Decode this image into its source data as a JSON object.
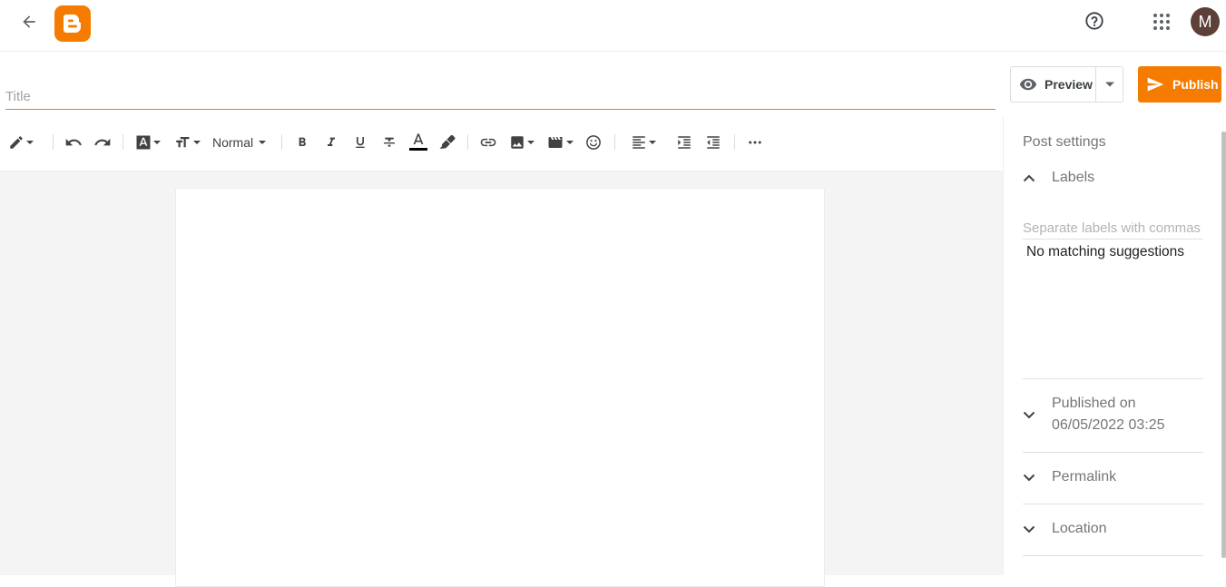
{
  "header": {
    "avatar_initial": "M"
  },
  "editor": {
    "title_placeholder": "Title",
    "preview_label": "Preview",
    "publish_label": "Publish",
    "format_label": "Normal"
  },
  "sidebar": {
    "title": "Post settings",
    "labels_heading": "Labels",
    "labels_placeholder": "Separate labels with commas",
    "no_suggestions": "No matching suggestions",
    "published_label": "Published on",
    "published_value": "06/05/2022 03:25",
    "permalink": "Permalink",
    "location": "Location"
  },
  "colors": {
    "brand": "#f57c00",
    "avatar_bg": "#5d4037",
    "text_color_underline": "#000000"
  },
  "icons": [
    "back-arrow-icon",
    "blogger-logo-icon",
    "help-icon",
    "apps-grid-icon",
    "eye-icon",
    "send-icon",
    "pencil-icon",
    "undo-icon",
    "redo-icon",
    "font-icon",
    "text-size-icon",
    "bold-icon",
    "italic-icon",
    "underline-icon",
    "strikethrough-icon",
    "text-color-icon",
    "highlight-icon",
    "link-icon",
    "image-icon",
    "video-icon",
    "emoji-icon",
    "align-left-icon",
    "indent-icon",
    "outdent-icon",
    "more-icon",
    "chevron-up-icon",
    "chevron-down-icon"
  ]
}
